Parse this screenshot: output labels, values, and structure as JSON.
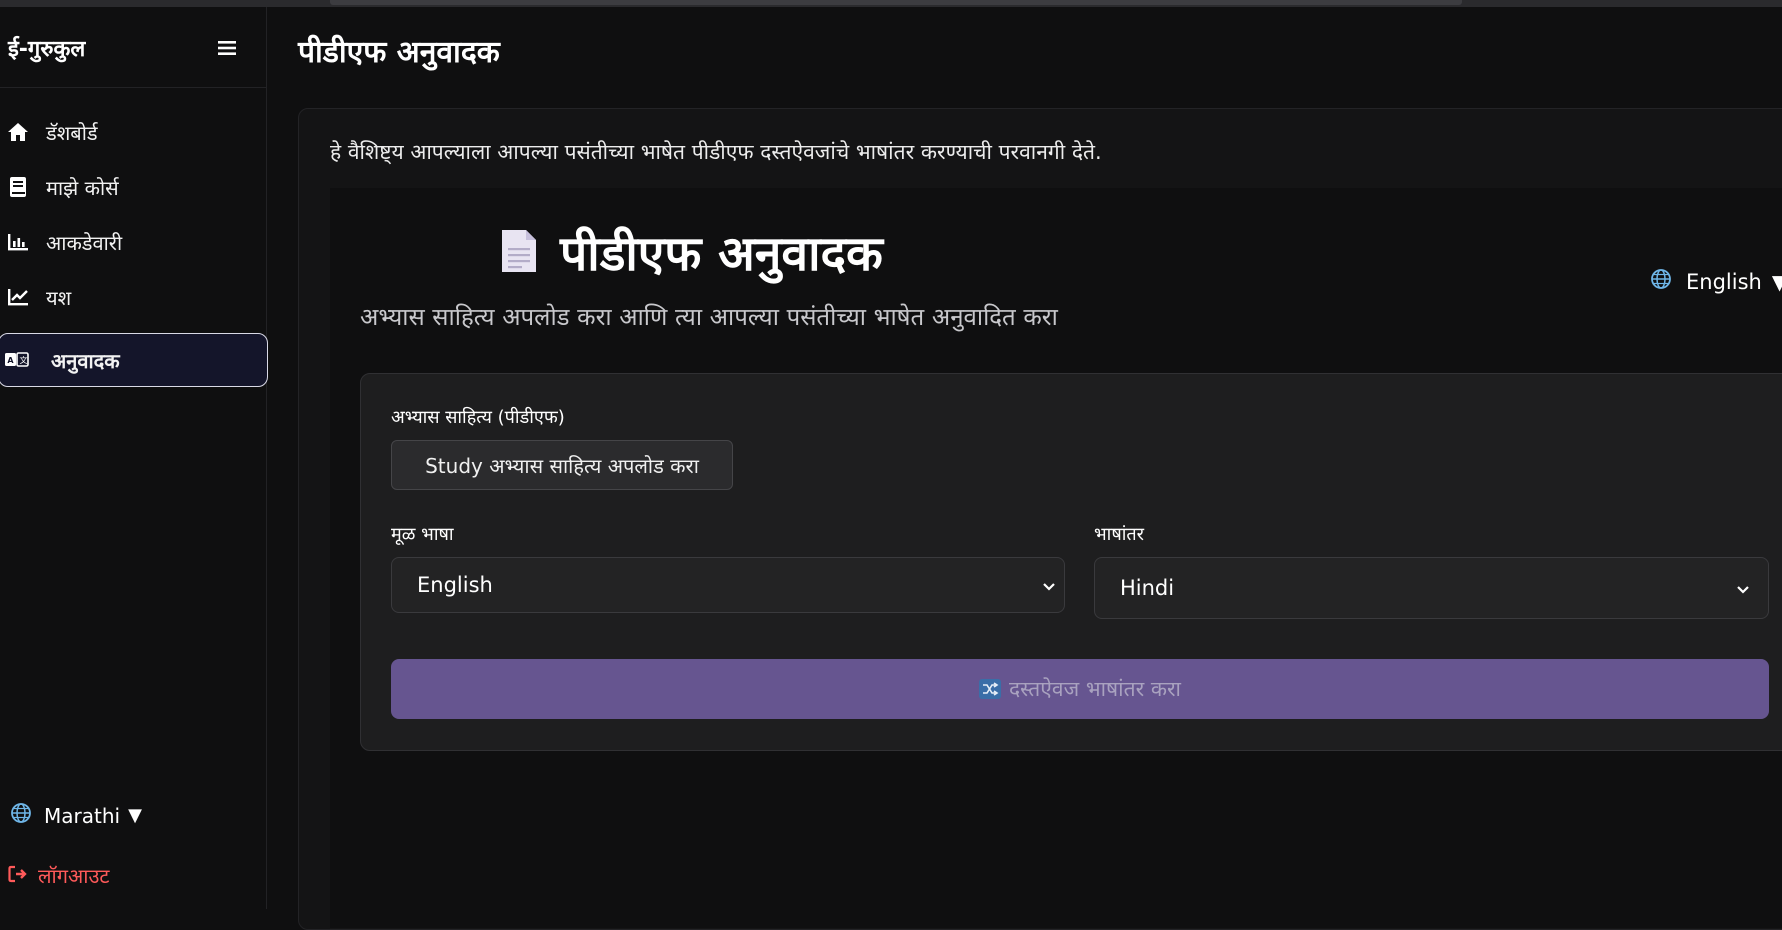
{
  "sidebar": {
    "brand": "ई-गुरुकुल",
    "items": [
      {
        "label": "डॅशबोर्ड",
        "icon": "home-icon"
      },
      {
        "label": "माझे कोर्स",
        "icon": "book-icon"
      },
      {
        "label": "आकडेवारी",
        "icon": "bar-chart-icon"
      },
      {
        "label": "यश",
        "icon": "trend-icon"
      },
      {
        "label": "अनुवादक",
        "icon": "translate-icon",
        "active": true
      }
    ],
    "language": "Marathi",
    "logout": "लॉगआउट"
  },
  "main": {
    "page_title": "पीडीएफ अनुवादक",
    "description": "हे वैशिष्ट्य आपल्याला आपल्या पसंतीच्या भाषेत पीडीएफ दस्तऐवजांचे भाषांतर करण्याची परवानगी देते.",
    "hero": {
      "title": "पीडीएफ अनुवादक",
      "subtitle": "अभ्यास साहित्य अपलोड करा आणि त्या आपल्या पसंतीच्या भाषेत अनुवादित करा"
    },
    "lang_switch": "English",
    "form": {
      "upload_label": "अभ्यास साहित्य (पीडीएफ)",
      "upload_button": "Study अभ्यास साहित्य अपलोड करा",
      "source_label": "मूळ भाषा",
      "source_value": "English",
      "target_label": "भाषांतर",
      "target_value": "Hindi",
      "translate_button": "दस्तऐवज भाषांतर करा"
    }
  },
  "colors": {
    "background": "#0f0f10",
    "card": "#1e1e1f",
    "accent_button": "#665590",
    "logout": "#ff5a5a",
    "active_nav_bg": "#14152a"
  }
}
